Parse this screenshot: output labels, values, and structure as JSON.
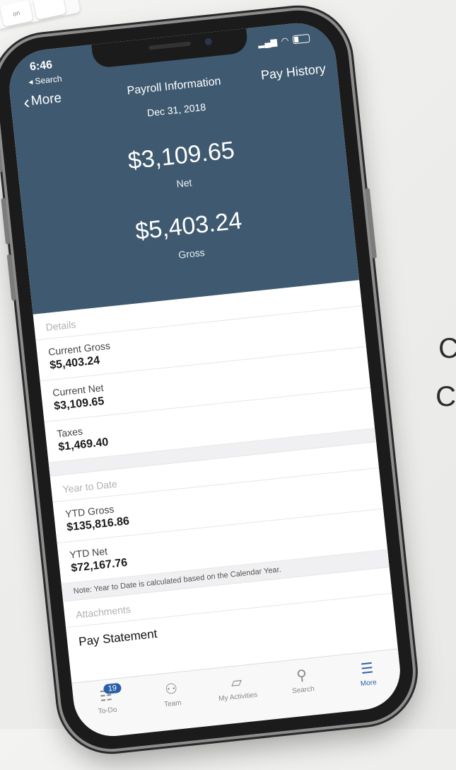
{
  "status": {
    "time": "6:46",
    "back_app": "◂ Search"
  },
  "nav": {
    "back_label": "More",
    "title": "Payroll Information",
    "right_label": "Pay History"
  },
  "summary": {
    "date": "Dec 31, 2018",
    "net_amount": "$3,109.65",
    "net_label": "Net",
    "gross_amount": "$5,403.24",
    "gross_label": "Gross"
  },
  "details": {
    "header": "Details",
    "rows": [
      {
        "label": "Current Gross",
        "value": "$5,403.24"
      },
      {
        "label": "Current Net",
        "value": "$3,109.65"
      },
      {
        "label": "Taxes",
        "value": "$1,469.40"
      }
    ]
  },
  "ytd": {
    "header": "Year to Date",
    "rows": [
      {
        "label": "YTD Gross",
        "value": "$135,816.86"
      },
      {
        "label": "YTD Net",
        "value": "$72,167.76"
      }
    ],
    "note": "Note: Year to Date is calculated based on the Calendar Year."
  },
  "attachments": {
    "header": "Attachments",
    "item": "Pay Statement"
  },
  "tabbar": {
    "tabs": [
      {
        "label": "To-Do",
        "icon": "todo-icon",
        "badge": "19"
      },
      {
        "label": "Team",
        "icon": "team-icon"
      },
      {
        "label": "My Activities",
        "icon": "chat-bubbles-icon"
      },
      {
        "label": "Search",
        "icon": "search-icon"
      },
      {
        "label": "More",
        "icon": "list-icon"
      }
    ]
  },
  "background": {
    "text1": "C",
    "text2": "C",
    "key1": "on"
  },
  "colors": {
    "header_bg": "#3f5a70",
    "accent": "#2b5ea9"
  }
}
